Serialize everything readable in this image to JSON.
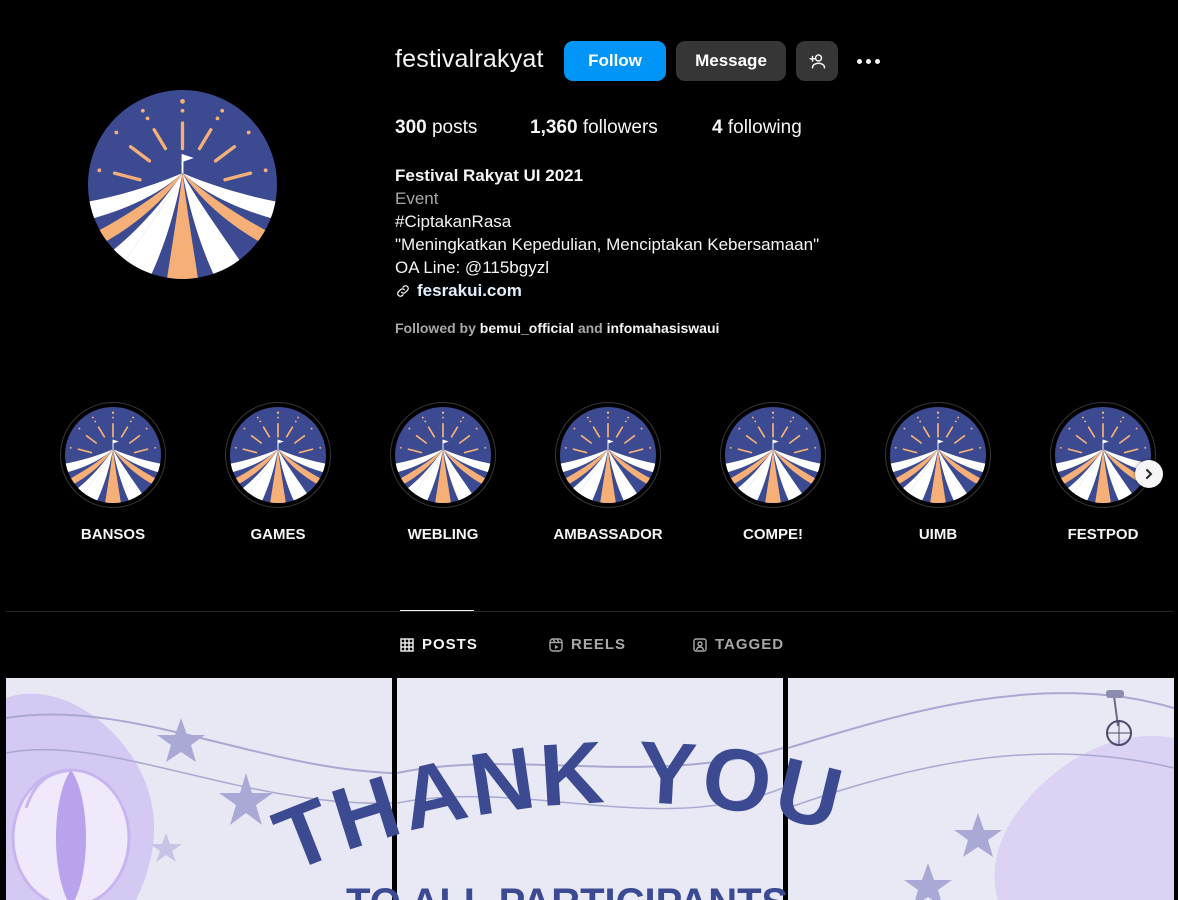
{
  "profile": {
    "username": "festivalrakyat",
    "follow_label": "Follow",
    "message_label": "Message",
    "add_user_icon": "add-user-icon",
    "more_icon": "more-options-icon",
    "stats": {
      "posts_count": "300",
      "posts_label": "posts",
      "followers_count": "1,360",
      "followers_label": "followers",
      "following_count": "4",
      "following_label": "following"
    },
    "bio": {
      "full_name": "Festival Rakyat UI 2021",
      "category": "Event",
      "line1": "#CiptakanRasa",
      "line2": "\"Meningkatkan Kepedulian, Menciptakan Kebersamaan\"",
      "line3": "OA Line: @115bgyzl",
      "website": "fesrakui.com"
    },
    "followed_by": {
      "prefix": "Followed by",
      "user1": "bemui_official",
      "joiner": "and",
      "user2": "infomahasiswaui"
    }
  },
  "highlights": [
    {
      "label": "BANSOS"
    },
    {
      "label": "GAMES"
    },
    {
      "label": "WEBLING"
    },
    {
      "label": "AMBASSADOR"
    },
    {
      "label": "COMPE!"
    },
    {
      "label": "UIMB"
    },
    {
      "label": "FESTPOD"
    }
  ],
  "tabs": [
    {
      "label": "POSTS",
      "icon": "grid-icon",
      "active": true
    },
    {
      "label": "REELS",
      "icon": "reels-icon",
      "active": false
    },
    {
      "label": "TAGGED",
      "icon": "tagged-icon",
      "active": false
    }
  ],
  "post_banner": {
    "headline": "THANK YOU",
    "subline": "TO ALL PARTICIPANTS"
  },
  "colors": {
    "brand_navy": "#3b4a91",
    "brand_orange": "#f6b077",
    "follow_blue": "#0095f6",
    "button_gray": "#363636",
    "lavender": "#e7e7f4"
  }
}
